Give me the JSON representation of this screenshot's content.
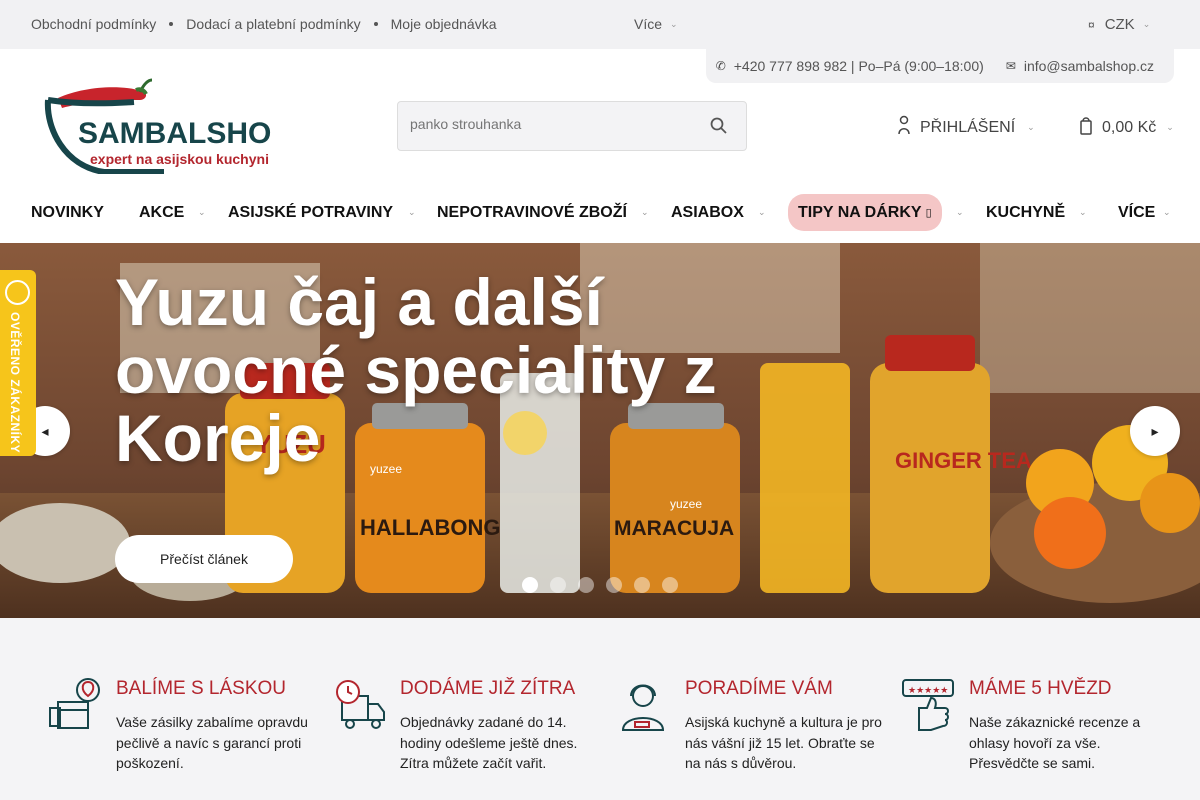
{
  "topbar": {
    "links": [
      "Obchodní podmínky",
      "Dodací a platební podmínky",
      "Moje objednávka"
    ],
    "more_label": "Více",
    "currency": "CZK"
  },
  "contact": {
    "phone": "+420 777 898 982 | Po–Pá (9:00–18:00)",
    "email": "info@sambalshop.cz"
  },
  "logo": {
    "name": "SAMBALSHOP",
    "tagline": "expert na asijskou kuchyni"
  },
  "search": {
    "placeholder": "panko strouhanka"
  },
  "account": {
    "login_label": "PŘIHLÁŠENÍ",
    "cart_total": "0,00 Kč"
  },
  "nav": {
    "items": [
      "NOVINKY",
      "AKCE",
      "ASIJSKÉ POTRAVINY",
      "NEPOTRAVINOVÉ ZBOŽÍ",
      "ASIABOX",
      "TIPY NA DÁRKY",
      "KUCHYNĚ",
      "VÍCE"
    ],
    "highlight_color": "#f4c6c6"
  },
  "hero": {
    "title": "Yuzu čaj a další ovocné speciality z Koreje",
    "button_label": "Přečíst článek",
    "slides_total": 6,
    "active_slide": 1,
    "jar_labels": [
      "YUZU",
      "HALLABONG",
      "MARACUJA",
      "GINGER TEA"
    ],
    "brand_labels": [
      "yuzee",
      "yuzee"
    ]
  },
  "badge": {
    "label": "OVĚŘENO ZÁKAZNÍKY",
    "color": "#f6c51b"
  },
  "benefits": [
    {
      "icon": "package-heart-icon",
      "title": "BALÍME S LÁSKOU",
      "text": "Vaše zásilky zabalíme opravdu pečlivě a navíc s garancí proti poškození."
    },
    {
      "icon": "delivery-truck-icon",
      "title": "DODÁME JIŽ ZÍTRA",
      "text": "Objednávky zadané do 14. hodiny odešleme ještě dnes. Zítra můžete začít vařit."
    },
    {
      "icon": "support-agent-icon",
      "title": "PORADÍME VÁM",
      "text": "Asijská kuchyně a kultura je pro nás vášní již 15 let. Obraťte se na nás s důvěrou."
    },
    {
      "icon": "five-stars-thumb-icon",
      "title": "MÁME 5 HVĚZD",
      "text": "Naše zákaznické recenze a ohlasy hovoří za vše. Přesvědčte se sami."
    }
  ],
  "colors": {
    "accent": "#b3262e",
    "logo_teal": "#17454a",
    "topbar_bg": "#f1f1f3"
  }
}
